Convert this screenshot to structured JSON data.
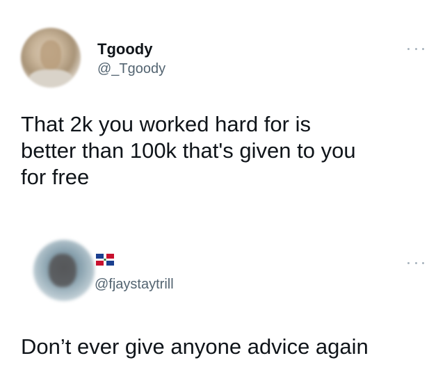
{
  "tweets": [
    {
      "display_name": "Tgoody",
      "handle": "@_Tgoody",
      "text_lines": [
        "That 2k you worked hard for is",
        "better than 100k that's given to you",
        "for free"
      ]
    },
    {
      "display_name": "",
      "flag": "dominican-republic-flag-icon",
      "handle": "@fjaystaytrill",
      "text_lines": [
        "Don’t ever give anyone advice again"
      ]
    }
  ],
  "colors": {
    "text": "#0f1419",
    "handle": "#536471",
    "more_dots": "#a8b3bd",
    "background": "#ffffff"
  }
}
